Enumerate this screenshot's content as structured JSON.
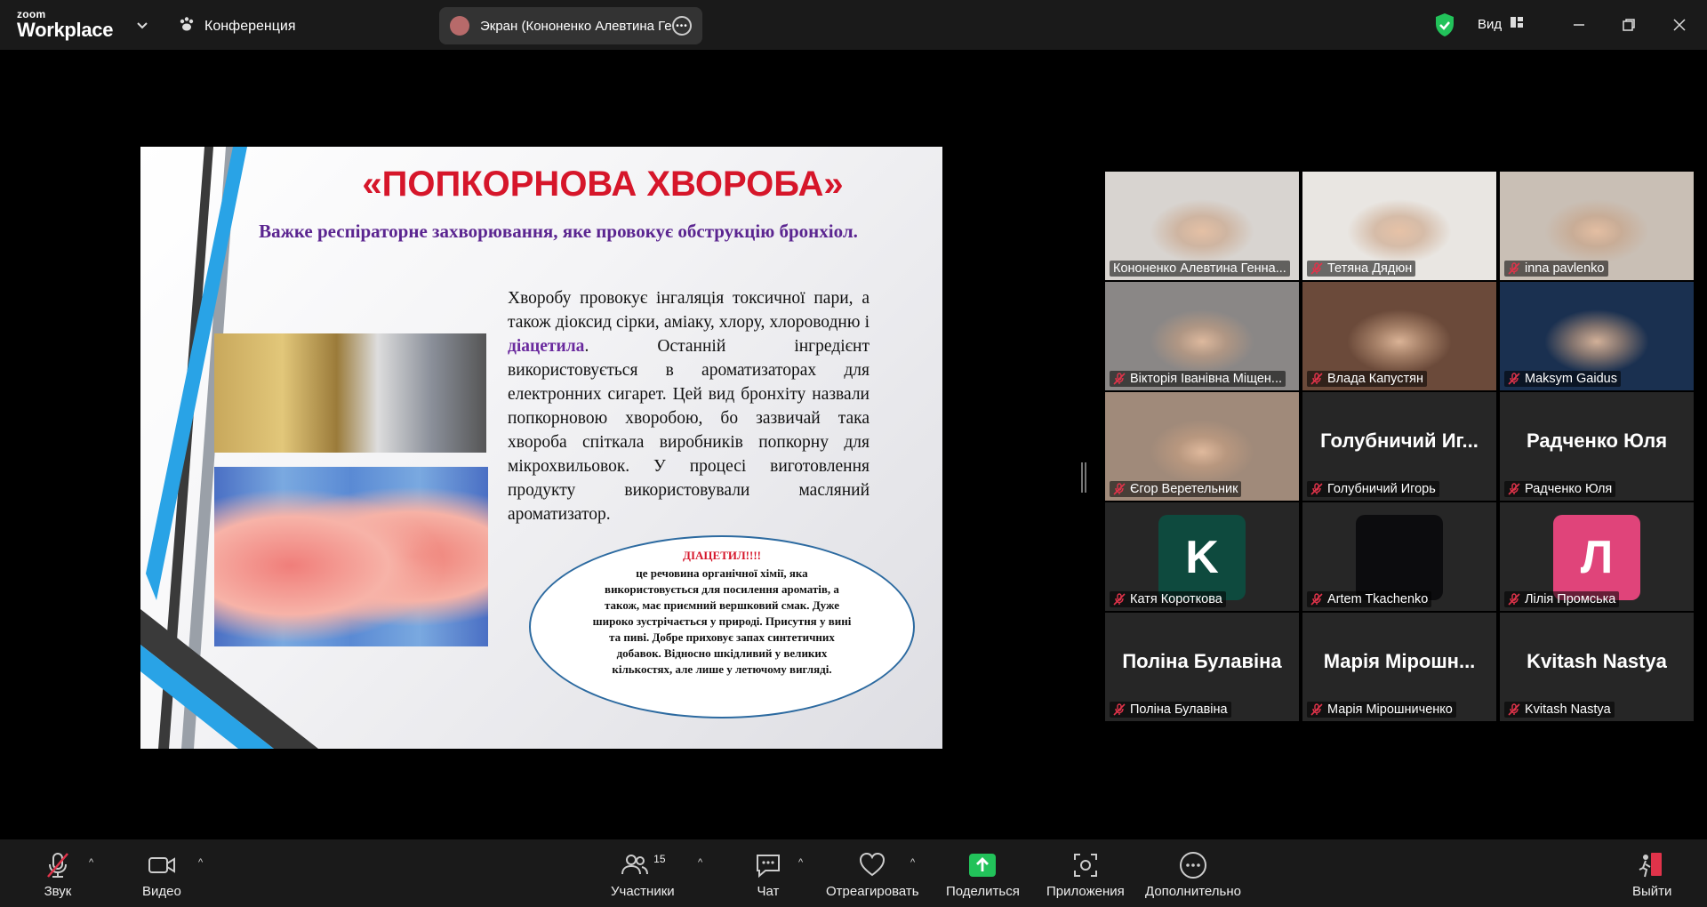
{
  "app": {
    "logo_top": "zoom",
    "logo_bottom": "Workplace",
    "meeting_label": "Конференция",
    "screen_share_label": "Экран (Кононенко Алевтина Ге",
    "view_label": "Вид"
  },
  "slide": {
    "title": "«ПОПКОРНОВА ХВОРОБА»",
    "subtitle": "Важке респіраторне захворювання, яке провокує обструкцію бронхіол.",
    "body_part1": "Хворобу провокує інгаляція токсичної пари, а також діоксид сірки, аміаку, хлору, хлороводню і ",
    "body_em": "діацетила",
    "body_part2": ". Останній інгредієнт використовується в ароматизаторах для електронних сигарет. Цей вид бронхіту назвали попкорновою хворобою, бо зазвичай така хвороба спіткала виробників попкорну для мікрохвильовок. У процесі виготовлення продукту використовували масляний ароматизатор.",
    "ellipse_title": "ДІАЦЕТИЛ!!!!",
    "ellipse_body": "це речовина органічної хімії, яка використовується для посилення ароматів, а також, має приємний вершковий смак. Дуже широко зустрічається у природі. Присутня у вині та пиві. Добре приховує запах синтетичних добавок. Відносно шкідливий у великих кількостях, але лише у летючому вигляді."
  },
  "participants": [
    {
      "name": "Кононенко Алевтина Генна...",
      "muted": false,
      "active": true,
      "video": "#d8d4d0"
    },
    {
      "name": "Тетяна Дядюн",
      "muted": true,
      "video": "#e9e6e2"
    },
    {
      "name": "inna pavlenko",
      "muted": true,
      "video": "#c9bfb5"
    },
    {
      "name": "Вікторія Іванівна Міщен...",
      "muted": true,
      "video": "#8a8786"
    },
    {
      "name": "Влада Капустян",
      "muted": true,
      "video": "#6b4a3a"
    },
    {
      "name": "Maksym Gaidus",
      "muted": true,
      "video": "#1a3050"
    },
    {
      "name": "Єгор Веретельник",
      "muted": true,
      "video": "#a08a7a"
    },
    {
      "name": "Голубничий Игорь",
      "muted": true,
      "big": "Голубничий Иг..."
    },
    {
      "name": "Радченко Юля",
      "muted": true,
      "big": "Радченко Юля"
    },
    {
      "name": "Катя Короткова",
      "muted": true,
      "letter": "K",
      "letter_bg": "#0e4a3e"
    },
    {
      "name": "Artem Tkachenko",
      "muted": true,
      "letter": "",
      "letter_bg": "#0c0c0e"
    },
    {
      "name": "Лілія Промська",
      "muted": true,
      "letter": "Л",
      "letter_bg": "#e0447a"
    },
    {
      "name": "Поліна Булавіна",
      "muted": true,
      "big": "Поліна Булавіна"
    },
    {
      "name": "Марія Мірошниченко",
      "muted": true,
      "big": "Марія Мірошн..."
    },
    {
      "name": "Kvitash Nastya",
      "muted": true,
      "big": "Kvitash Nastya"
    }
  ],
  "toolbar": {
    "audio": "Звук",
    "video": "Видео",
    "participants": "Участники",
    "participants_count": "15",
    "chat": "Чат",
    "react": "Отреагировать",
    "share": "Поделиться",
    "apps": "Приложения",
    "more": "Дополнительно",
    "leave": "Выйти"
  },
  "colors": {
    "active_speaker": "#2fd072",
    "share_green": "#22c25a",
    "leave_red": "#e0334a"
  }
}
